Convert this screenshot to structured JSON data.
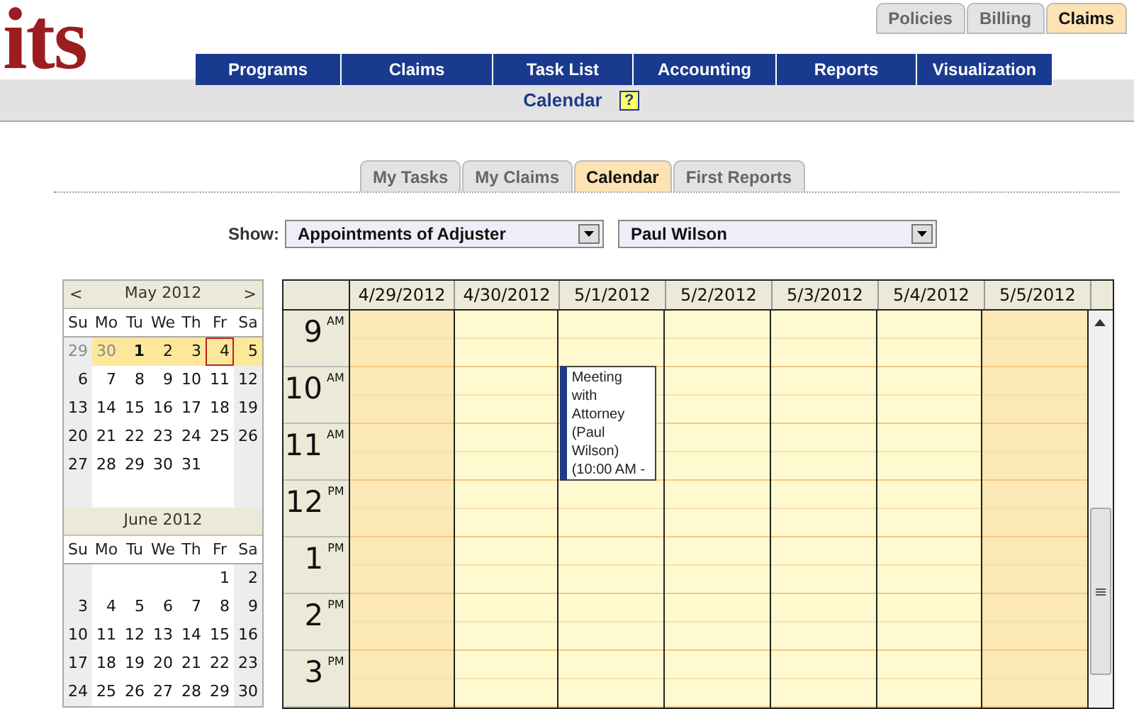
{
  "logo": "its",
  "top_tabs": [
    {
      "label": "Policies",
      "selected": false
    },
    {
      "label": "Billing",
      "selected": false
    },
    {
      "label": "Claims",
      "selected": true
    }
  ],
  "nav": [
    "Programs",
    "Claims",
    "Task List",
    "Accounting",
    "Reports",
    "Visualization"
  ],
  "page_title": "Calendar",
  "help": "?",
  "sub_tabs": [
    {
      "label": "My Tasks",
      "selected": false
    },
    {
      "label": "My Claims",
      "selected": false
    },
    {
      "label": "Calendar",
      "selected": true
    },
    {
      "label": "First Reports",
      "selected": false
    }
  ],
  "filter": {
    "label": "Show:",
    "type": "Appointments of Adjuster",
    "person": "Paul Wilson"
  },
  "months": [
    {
      "title": "May 2012",
      "prev": "<",
      "next": ">",
      "weekdays": [
        "Su",
        "Mo",
        "Tu",
        "We",
        "Th",
        "Fr",
        "Sa"
      ],
      "weeks": [
        {
          "selected": true,
          "days": [
            {
              "label": "29",
              "muted": true,
              "bold": false,
              "outlined": false
            },
            {
              "label": "30",
              "muted": true,
              "bold": false,
              "outlined": false
            },
            {
              "label": "1",
              "muted": false,
              "bold": true,
              "outlined": false
            },
            {
              "label": "2",
              "muted": false,
              "bold": false,
              "outlined": false
            },
            {
              "label": "3",
              "muted": false,
              "bold": false,
              "outlined": false
            },
            {
              "label": "4",
              "muted": false,
              "bold": false,
              "outlined": true
            },
            {
              "label": "5",
              "muted": false,
              "bold": false,
              "outlined": false
            }
          ]
        },
        {
          "selected": false,
          "days": [
            {
              "label": "6",
              "muted": false,
              "bold": false,
              "outlined": false
            },
            {
              "label": "7",
              "muted": false,
              "bold": false,
              "outlined": false
            },
            {
              "label": "8",
              "muted": false,
              "bold": false,
              "outlined": false
            },
            {
              "label": "9",
              "muted": false,
              "bold": false,
              "outlined": false
            },
            {
              "label": "10",
              "muted": false,
              "bold": false,
              "outlined": false
            },
            {
              "label": "11",
              "muted": false,
              "bold": false,
              "outlined": false
            },
            {
              "label": "12",
              "muted": false,
              "bold": false,
              "outlined": false
            }
          ]
        },
        {
          "selected": false,
          "days": [
            {
              "label": "13",
              "muted": false,
              "bold": false,
              "outlined": false
            },
            {
              "label": "14",
              "muted": false,
              "bold": false,
              "outlined": false
            },
            {
              "label": "15",
              "muted": false,
              "bold": false,
              "outlined": false
            },
            {
              "label": "16",
              "muted": false,
              "bold": false,
              "outlined": false
            },
            {
              "label": "17",
              "muted": false,
              "bold": false,
              "outlined": false
            },
            {
              "label": "18",
              "muted": false,
              "bold": false,
              "outlined": false
            },
            {
              "label": "19",
              "muted": false,
              "bold": false,
              "outlined": false
            }
          ]
        },
        {
          "selected": false,
          "days": [
            {
              "label": "20",
              "muted": false,
              "bold": false,
              "outlined": false
            },
            {
              "label": "21",
              "muted": false,
              "bold": false,
              "outlined": false
            },
            {
              "label": "22",
              "muted": false,
              "bold": false,
              "outlined": false
            },
            {
              "label": "23",
              "muted": false,
              "bold": false,
              "outlined": false
            },
            {
              "label": "24",
              "muted": false,
              "bold": false,
              "outlined": false
            },
            {
              "label": "25",
              "muted": false,
              "bold": false,
              "outlined": false
            },
            {
              "label": "26",
              "muted": false,
              "bold": false,
              "outlined": false
            }
          ]
        },
        {
          "selected": false,
          "days": [
            {
              "label": "27",
              "muted": false,
              "bold": false,
              "outlined": false
            },
            {
              "label": "28",
              "muted": false,
              "bold": false,
              "outlined": false
            },
            {
              "label": "29",
              "muted": false,
              "bold": false,
              "outlined": false
            },
            {
              "label": "30",
              "muted": false,
              "bold": false,
              "outlined": false
            },
            {
              "label": "31",
              "muted": false,
              "bold": false,
              "outlined": false
            }
          ]
        }
      ]
    },
    {
      "title": "June 2012",
      "weekdays": [
        "Su",
        "Mo",
        "Tu",
        "We",
        "Th",
        "Fr",
        "Sa"
      ],
      "weeks": [
        {
          "selected": false,
          "days": [
            {
              "label": "1",
              "muted": false,
              "bold": false,
              "outlined": false
            },
            {
              "label": "2",
              "muted": false,
              "bold": false,
              "outlined": false
            }
          ]
        },
        {
          "selected": false,
          "days": [
            {
              "label": "3",
              "muted": false,
              "bold": false,
              "outlined": false
            },
            {
              "label": "4",
              "muted": false,
              "bold": false,
              "outlined": false
            },
            {
              "label": "5",
              "muted": false,
              "bold": false,
              "outlined": false
            },
            {
              "label": "6",
              "muted": false,
              "bold": false,
              "outlined": false
            },
            {
              "label": "7",
              "muted": false,
              "bold": false,
              "outlined": false
            },
            {
              "label": "8",
              "muted": false,
              "bold": false,
              "outlined": false
            },
            {
              "label": "9",
              "muted": false,
              "bold": false,
              "outlined": false
            }
          ]
        },
        {
          "selected": false,
          "days": [
            {
              "label": "10",
              "muted": false,
              "bold": false,
              "outlined": false
            },
            {
              "label": "11",
              "muted": false,
              "bold": false,
              "outlined": false
            },
            {
              "label": "12",
              "muted": false,
              "bold": false,
              "outlined": false
            },
            {
              "label": "13",
              "muted": false,
              "bold": false,
              "outlined": false
            },
            {
              "label": "14",
              "muted": false,
              "bold": false,
              "outlined": false
            },
            {
              "label": "15",
              "muted": false,
              "bold": false,
              "outlined": false
            },
            {
              "label": "16",
              "muted": false,
              "bold": false,
              "outlined": false
            }
          ]
        },
        {
          "selected": false,
          "days": [
            {
              "label": "17",
              "muted": false,
              "bold": false,
              "outlined": false
            },
            {
              "label": "18",
              "muted": false,
              "bold": false,
              "outlined": false
            },
            {
              "label": "19",
              "muted": false,
              "bold": false,
              "outlined": false
            },
            {
              "label": "20",
              "muted": false,
              "bold": false,
              "outlined": false
            },
            {
              "label": "21",
              "muted": false,
              "bold": false,
              "outlined": false
            },
            {
              "label": "22",
              "muted": false,
              "bold": false,
              "outlined": false
            },
            {
              "label": "23",
              "muted": false,
              "bold": false,
              "outlined": false
            }
          ]
        },
        {
          "selected": false,
          "days": [
            {
              "label": "24",
              "muted": false,
              "bold": false,
              "outlined": false
            },
            {
              "label": "25",
              "muted": false,
              "bold": false,
              "outlined": false
            },
            {
              "label": "26",
              "muted": false,
              "bold": false,
              "outlined": false
            },
            {
              "label": "27",
              "muted": false,
              "bold": false,
              "outlined": false
            },
            {
              "label": "28",
              "muted": false,
              "bold": false,
              "outlined": false
            },
            {
              "label": "29",
              "muted": false,
              "bold": false,
              "outlined": false
            },
            {
              "label": "30",
              "muted": false,
              "bold": false,
              "outlined": false
            }
          ]
        }
      ]
    }
  ],
  "schedule": {
    "hours": [
      {
        "hour": "9",
        "period": "AM"
      },
      {
        "hour": "10",
        "period": "AM"
      },
      {
        "hour": "11",
        "period": "AM"
      },
      {
        "hour": "12",
        "period": "PM"
      },
      {
        "hour": "1",
        "period": "PM"
      },
      {
        "hour": "2",
        "period": "PM"
      },
      {
        "hour": "3",
        "period": "PM"
      }
    ],
    "days": [
      {
        "label": "4/29/2012",
        "weekend": true
      },
      {
        "label": "4/30/2012",
        "weekend": false
      },
      {
        "label": "5/1/2012",
        "weekend": false,
        "events": [
          {
            "title": "Meeting with Attorney (Paul Wilson) (10:00 AM -"
          }
        ]
      },
      {
        "label": "5/2/2012",
        "weekend": false
      },
      {
        "label": "5/3/2012",
        "weekend": false
      },
      {
        "label": "5/4/2012",
        "weekend": false
      },
      {
        "label": "5/5/2012",
        "weekend": true
      }
    ]
  }
}
